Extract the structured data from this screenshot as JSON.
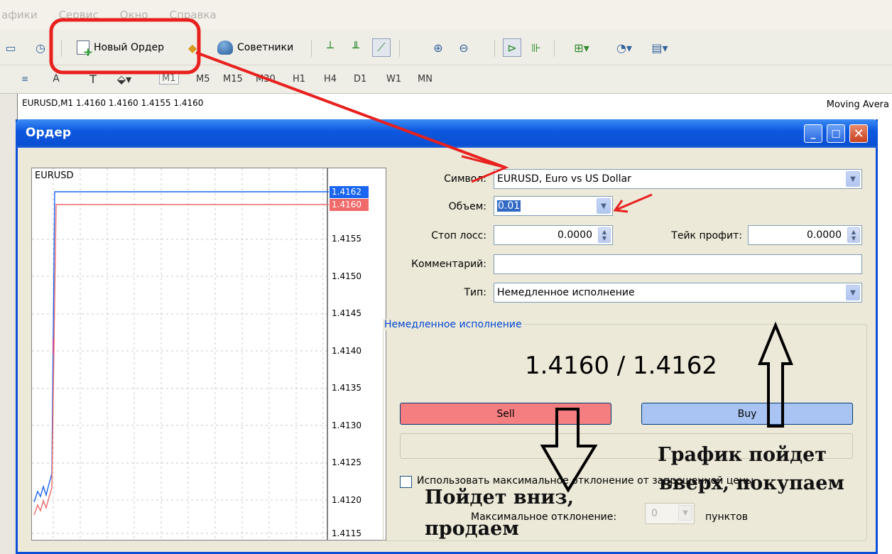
{
  "menu": [
    "афики",
    "Сервис",
    "Окно",
    "Справка"
  ],
  "toolbar": {
    "new_order_label": "Новый Ордер",
    "experts_label": "Советники"
  },
  "timeframes": [
    "M1",
    "M5",
    "M15",
    "M30",
    "H1",
    "H4",
    "D1",
    "W1",
    "MN"
  ],
  "chart": {
    "header": "EURUSD,M1  1.4160 1.4160 1.4155 1.4160",
    "indicator": "Moving Avera"
  },
  "dialog": {
    "title": "Ордер",
    "minimize": "_",
    "maximize": "□",
    "close": "✕"
  },
  "mini_chart": {
    "symbol": "EURUSD",
    "ask_tag": "1.4162",
    "bid_tag": "1.4160",
    "ask_color": "#1a66f0",
    "bid_color": "#f06a6a",
    "price_labels": [
      "1.4155",
      "1.4150",
      "1.4145",
      "1.4140",
      "1.4135",
      "1.4130",
      "1.4125",
      "1.4120",
      "1.4115"
    ]
  },
  "form": {
    "symbol_label": "Символ:",
    "symbol_value": "EURUSD, Euro vs US Dollar",
    "volume_label": "Объем:",
    "volume_value": "0.01",
    "stoploss_label": "Стоп лосс:",
    "stoploss_value": "0.0000",
    "takeprofit_label": "Тейк профит:",
    "takeprofit_value": "0.0000",
    "comment_label": "Комментарий:",
    "comment_value": "",
    "type_label": "Тип:",
    "type_value": "Немедленное исполнение"
  },
  "execution": {
    "group_title": "Немедленное исполнение",
    "quote": "1.4160 / 1.4162",
    "sell_label": "Sell",
    "buy_label": "Buy",
    "deviation_checkbox_label": "Использовать максимальное отклонение от запрошенной цены",
    "max_deviation_label": "Максимальное отклонение:",
    "max_deviation_value": "0",
    "points_label": "пунктов",
    "sell_color": "#f57e80",
    "buy_color": "#a9c4f2"
  },
  "annotations": {
    "up_line1": "График пойдет",
    "up_line2": "вверх, покупаем",
    "down_line1": "Пойдет вниз,",
    "down_line2": "продаем",
    "highlight_color": "#e8201e"
  }
}
